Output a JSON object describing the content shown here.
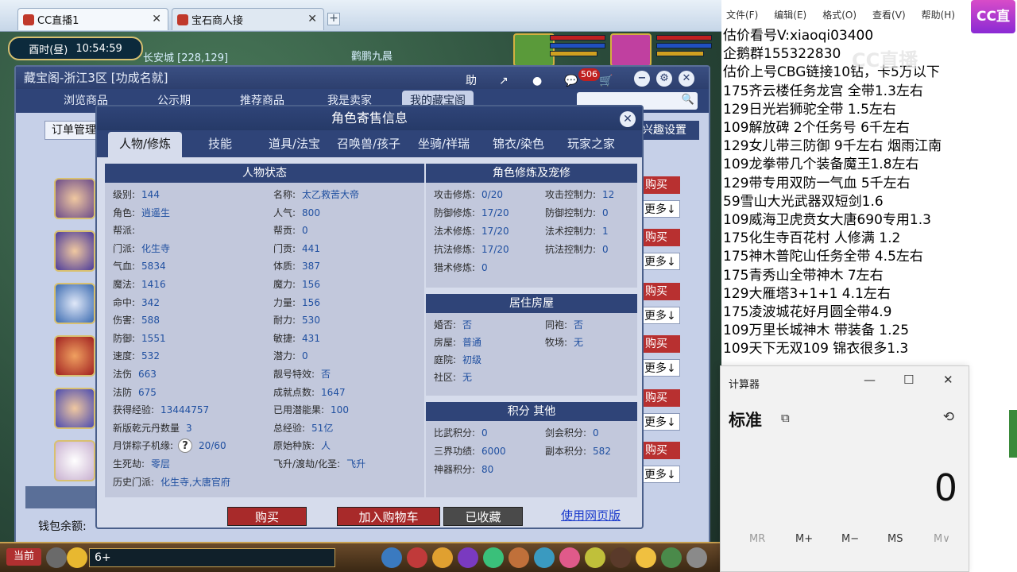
{
  "browser": {
    "tabs": [
      {
        "label": "CC直播1"
      },
      {
        "label": "宝石商人接"
      }
    ],
    "add_tab": "+"
  },
  "game": {
    "clock": {
      "period": "酉时(昼)",
      "time": "10:54:59"
    },
    "scene_text_1": "长安城 [228,129]",
    "scene_text_2": "鹳鹏九晨"
  },
  "treasure_window": {
    "title": "藏宝阁-浙江3区 [功成名就]",
    "toolbar": {
      "help": "助",
      "share": "↗",
      "stop": "●",
      "message_badge": "506",
      "cart": "🛒"
    },
    "nav_tabs": [
      "浏览商品",
      "公示期",
      "推荐商品",
      "我是卖家",
      "我的藏宝阁"
    ],
    "active_tab": "我的藏宝阁",
    "order_manage": "订单管理",
    "interest_settings": "兴趣设置",
    "buy_label": "购买",
    "more_label": "更多↓",
    "wallet_label": "钱包余额:"
  },
  "char_dialog": {
    "title": "角色寄售信息",
    "tabs": [
      "人物/修炼",
      "技能",
      "道具/法宝",
      "召唤兽/孩子",
      "坐骑/祥瑞",
      "锦衣/染色",
      "玩家之家"
    ],
    "status_header": "人物状态",
    "left_col": [
      {
        "label": "级别:",
        "value": "144"
      },
      {
        "label": "角色:",
        "value": "逍遥生"
      },
      {
        "label": "帮派:",
        "value": ""
      },
      {
        "label": "门派:",
        "value": "化生寺"
      },
      {
        "label": "气血:",
        "value": "5834"
      },
      {
        "label": "魔法:",
        "value": "1416"
      },
      {
        "label": "命中:",
        "value": "342"
      },
      {
        "label": "伤害:",
        "value": "588"
      },
      {
        "label": "防御:",
        "value": "1551"
      },
      {
        "label": "速度:",
        "value": "532"
      },
      {
        "label": "法伤",
        "value": "663"
      },
      {
        "label": "法防",
        "value": "675"
      },
      {
        "label": "获得经验:",
        "value": "13444757"
      },
      {
        "label": "新版乾元丹数量",
        "value": "3"
      },
      {
        "label": "月饼粽子机缘:",
        "value": "20/60"
      },
      {
        "label": "生死劫:",
        "value": "零层"
      },
      {
        "label": "历史门派:",
        "value": "化生寺,大唐官府"
      }
    ],
    "right_col": [
      {
        "label": "名称:",
        "value": "太乙救苦大帝"
      },
      {
        "label": "人气:",
        "value": "800"
      },
      {
        "label": "帮贡:",
        "value": "0"
      },
      {
        "label": "门贡:",
        "value": "441"
      },
      {
        "label": "体质:",
        "value": "387"
      },
      {
        "label": "魔力:",
        "value": "156"
      },
      {
        "label": "力量:",
        "value": "156"
      },
      {
        "label": "耐力:",
        "value": "530"
      },
      {
        "label": "敏捷:",
        "value": "431"
      },
      {
        "label": "潜力:",
        "value": "0"
      },
      {
        "label": "靓号特效:",
        "value": "否"
      },
      {
        "label": "成就点数:",
        "value": "1647"
      },
      {
        "label": "已用潜能果:",
        "value": "100"
      },
      {
        "label": "总经验:",
        "value": "51亿"
      },
      {
        "label": "原始种族:",
        "value": "人"
      },
      {
        "label": "飞升/渡劫/化圣:",
        "value": "飞升"
      }
    ],
    "help_icon": "?",
    "cultivation_header": "角色修炼及宠修",
    "cultivation": [
      {
        "label": "攻击修炼:",
        "value": "0/20",
        "label2": "攻击控制力:",
        "value2": "12"
      },
      {
        "label": "防御修炼:",
        "value": "17/20",
        "label2": "防御控制力:",
        "value2": "0"
      },
      {
        "label": "法术修炼:",
        "value": "17/20",
        "label2": "法术控制力:",
        "value2": "1"
      },
      {
        "label": "抗法修炼:",
        "value": "17/20",
        "label2": "抗法控制力:",
        "value2": "0"
      },
      {
        "label": "猎术修炼:",
        "value": "0",
        "label2": "",
        "value2": ""
      }
    ],
    "house_header": "居住房屋",
    "house": [
      {
        "label": "婚否:",
        "value": "否",
        "label2": "同袍:",
        "value2": "否"
      },
      {
        "label": "房屋:",
        "value": "普通",
        "label2": "牧场:",
        "value2": "无"
      },
      {
        "label": "庭院:",
        "value": "初级",
        "label2": "",
        "value2": ""
      },
      {
        "label": "社区:",
        "value": "无",
        "label2": "",
        "value2": ""
      }
    ],
    "points_header": "积分 其他",
    "points": [
      {
        "label": "比武积分:",
        "value": "0",
        "label2": "剑会积分:",
        "value2": "0"
      },
      {
        "label": "三界功绩:",
        "value": "6000",
        "label2": "副本积分:",
        "value2": "582"
      },
      {
        "label": "神器积分:",
        "value": "80",
        "label2": "",
        "value2": ""
      }
    ],
    "buttons": {
      "buy": "购买",
      "add_cart": "加入购物车",
      "favorited": "已收藏",
      "web": "使用网页版"
    }
  },
  "chat": {
    "current": "当前",
    "input": "6+"
  },
  "notepad": {
    "menu": [
      "文件(F)",
      "编辑(E)",
      "格式(O)",
      "查看(V)",
      "帮助(H)"
    ],
    "lines": [
      "估价看号V:xiaoqi03400",
      "企鹅群155322830",
      "估价上号CBG链接10钻，卡5万以下",
      "175齐云楼任务龙宫  全带1.3左右",
      "129日光岩狮驼全带  1.5左右",
      "109解放碑 2个任务号 6千左右",
      "129女儿带三防御 9千左右 烟雨江南",
      "109龙拳带几个装备魔王1.8左右",
      "129带专用双防一气血 5千左右",
      "59雪山大光武器双短剑1.6",
      "109威海卫虎贲女大唐690专用1.3",
      "175化生寺百花村 人修满 1.2",
      "175神木普陀山任务全带 4.5左右",
      "175青秀山全带神木  7左右",
      "129大雁塔3+1+1  4.1左右",
      "175凌波城花好月圆全带4.9",
      "109万里长城神木 带装备  1.25",
      "109天下无双109  锦衣很多1.3"
    ]
  },
  "overlay": {
    "logo": "CC直播",
    "watermark": "CC直播"
  },
  "calculator": {
    "title": "计算器",
    "mode": "标准",
    "display": "0",
    "memory": [
      "MR",
      "M+",
      "M−",
      "MS",
      "M∨"
    ]
  }
}
